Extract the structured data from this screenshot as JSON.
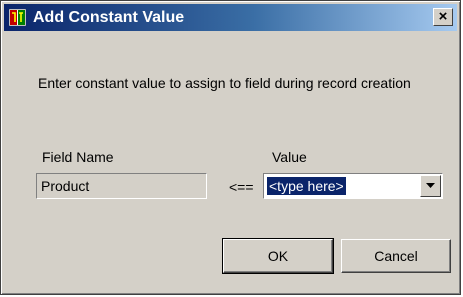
{
  "window": {
    "title": "Add Constant Value",
    "app_icon": "app-icon",
    "close_label": "×"
  },
  "instruction": "Enter constant value  to assign to field during record creation",
  "field_name": {
    "label": "Field Name",
    "value": "Product"
  },
  "assign_arrow": "<==",
  "value_field": {
    "label": "Value",
    "value": "<type here>",
    "dropdown_icon": "chevron-down-icon"
  },
  "buttons": {
    "ok": "OK",
    "cancel": "Cancel"
  },
  "colors": {
    "titlebar_start": "#0a246a",
    "titlebar_end": "#a6caf0",
    "face": "#d4d0c8",
    "selection": "#0a246a"
  }
}
